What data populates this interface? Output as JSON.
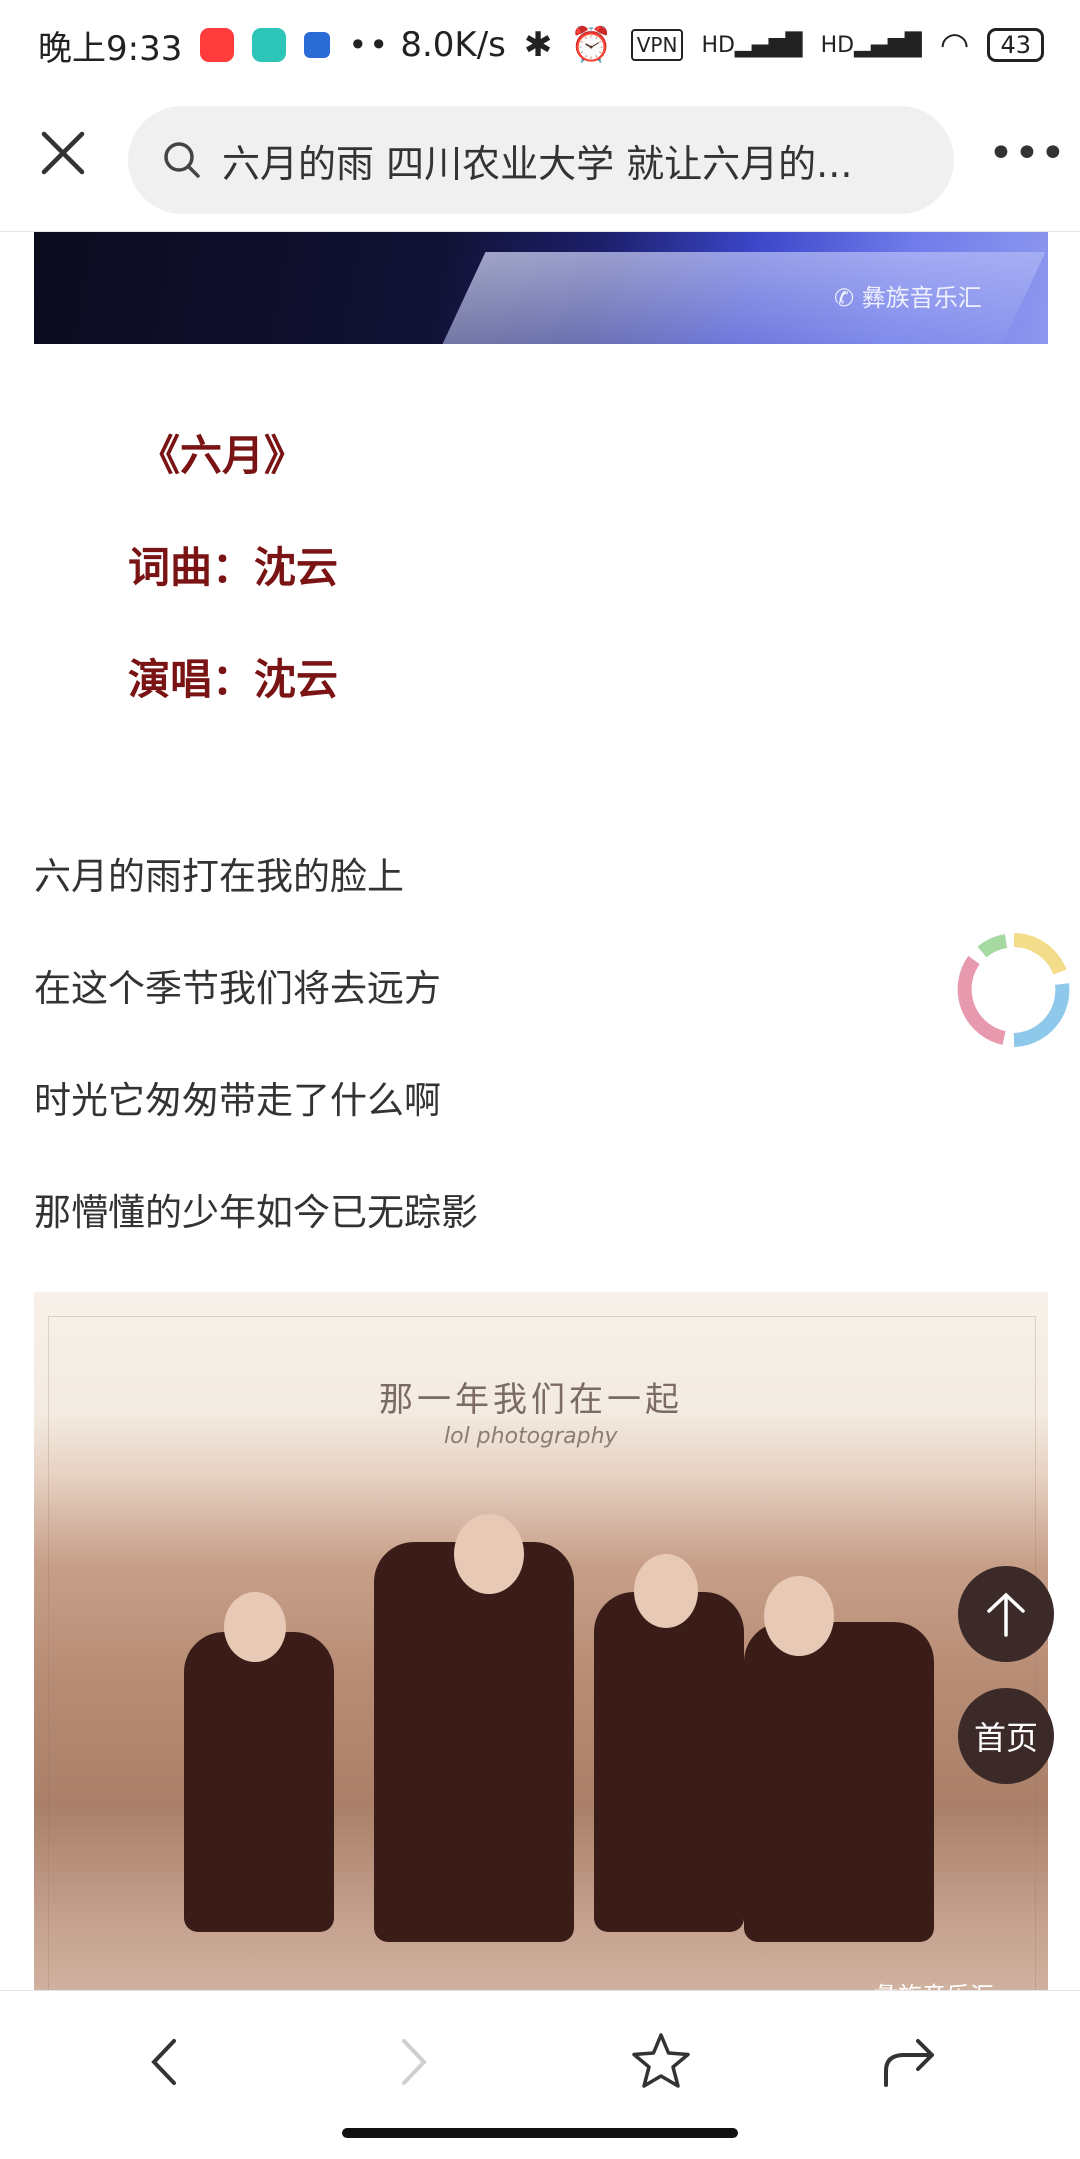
{
  "status_bar": {
    "time": "晚上9:33",
    "network_speed": "8.0K/s",
    "vpn": "VPN",
    "hd1": "HD",
    "hd2": "HD",
    "battery": "43"
  },
  "nav": {
    "close_icon": "close-icon",
    "search_text": "六月的雨 四川农业大学  就让六月的...",
    "more_icon": "more-icon"
  },
  "article": {
    "watermark_top": "彝族音乐汇",
    "song_title": "《六月》",
    "lyricist": "词曲：沈云",
    "singer": "演唱：沈云",
    "lyrics": [
      "六月的雨打在我的脸上",
      "在这个季节我们将去远方",
      "时光它匆匆带走了什么啊",
      "那懵懂的少年如今已无踪影"
    ],
    "photo_caption": "那一年我们在一起",
    "photo_subcaption": "lol photography",
    "photo_watermark": "彝族音乐汇"
  },
  "floating": {
    "back_to_top_icon": "arrow-up-icon",
    "home_label": "首页"
  },
  "bottom_bar": {
    "back_icon": "chevron-left-icon",
    "forward_icon": "chevron-right-icon",
    "favorite_icon": "star-icon",
    "share_icon": "share-icon"
  },
  "colors": {
    "credit_red": "#7a1313",
    "fab_bg": "#3b2a28"
  }
}
